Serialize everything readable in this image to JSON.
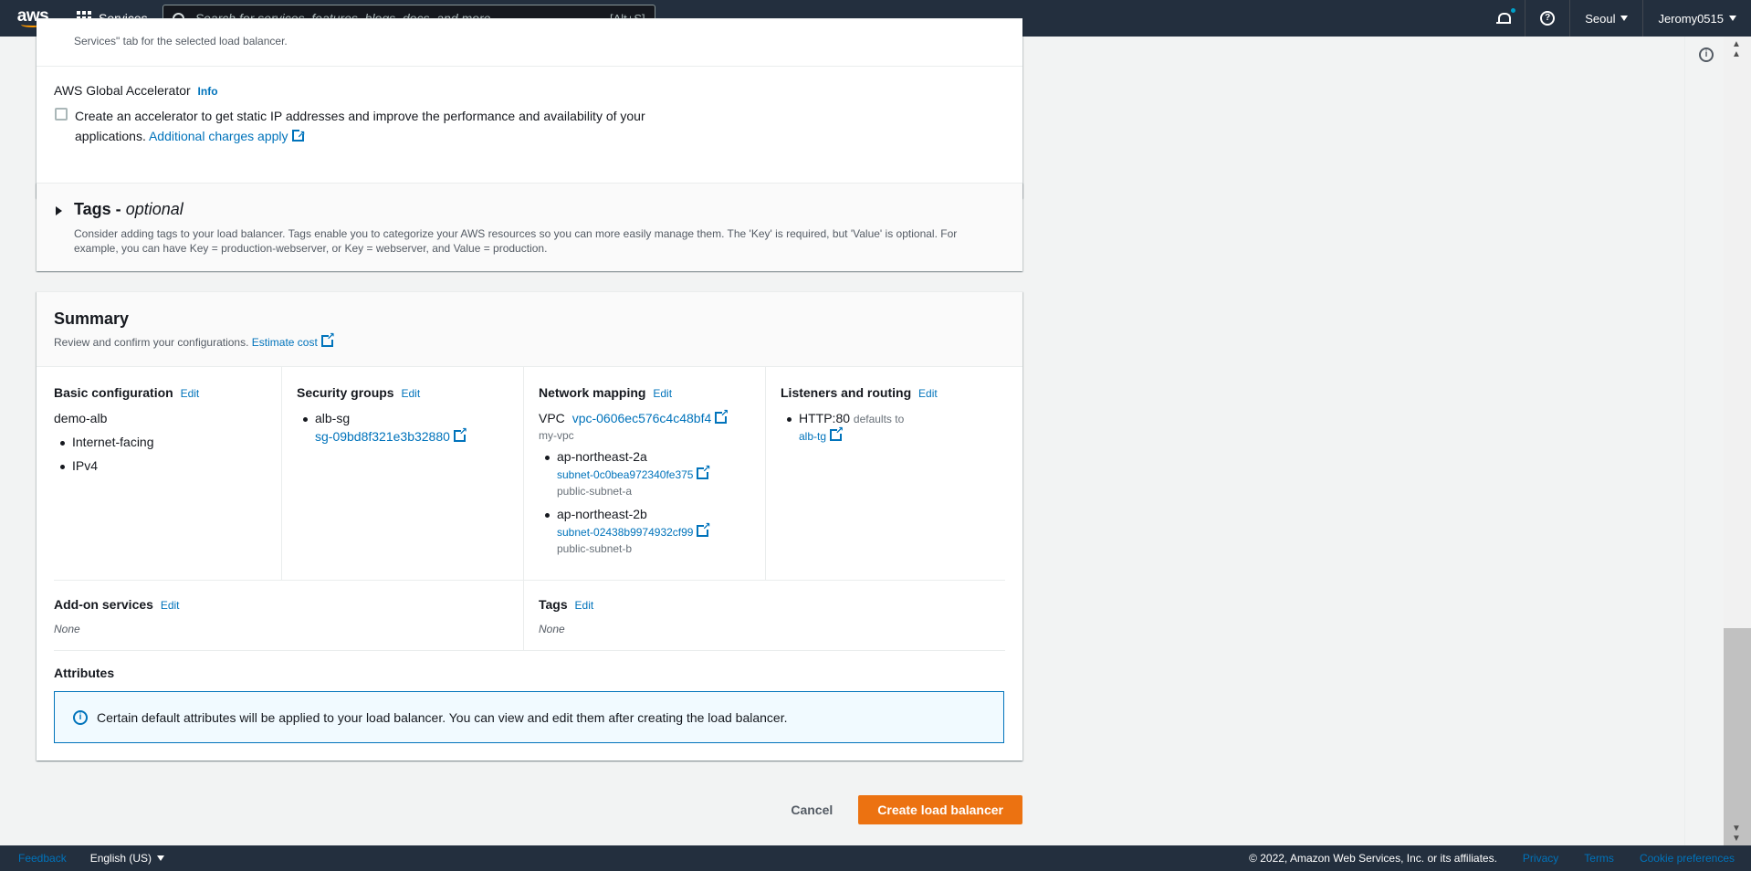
{
  "nav": {
    "logo": "aws",
    "services_label": "Services",
    "search_placeholder": "Search for services, features, blogs, docs, and more",
    "search_shortcut": "[Alt+S]",
    "region": "Seoul",
    "account": "Jeromy0515"
  },
  "panel_top": {
    "note": "Services\" tab for the selected load balancer.",
    "ga_title": "AWS Global Accelerator",
    "info": "Info",
    "ga_checkbox_text": "Create an accelerator to get static IP addresses and improve the performance and availability of your applications.",
    "ga_link": "Additional charges apply",
    "checked": false
  },
  "tags_panel": {
    "title": "Tags -",
    "title_optional": "optional",
    "description": "Consider adding tags to your load balancer. Tags enable you to categorize your AWS resources so you can more easily manage them. The 'Key' is required, but 'Value' is optional. For example, you can have Key = production-webserver, or Key = webserver, and Value = production."
  },
  "summary": {
    "title": "Summary",
    "description": "Review and confirm your configurations.",
    "estimate_link": "Estimate cost",
    "edit_label": "Edit",
    "basic": {
      "title": "Basic configuration",
      "name": "demo-alb",
      "items": [
        "Internet-facing",
        "IPv4"
      ]
    },
    "security_groups": {
      "title": "Security groups",
      "name": "alb-sg",
      "id": "sg-09bd8f321e3b32880"
    },
    "network": {
      "title": "Network mapping",
      "vpc_label": "VPC",
      "vpc_id": "vpc-0606ec576c4c48bf4",
      "vpc_name": "my-vpc",
      "zones": [
        {
          "az": "ap-northeast-2a",
          "subnet_id": "subnet-0c0bea972340fe375",
          "subnet_name": "public-subnet-a"
        },
        {
          "az": "ap-northeast-2b",
          "subnet_id": "subnet-02438b9974932cf99",
          "subnet_name": "public-subnet-b"
        }
      ]
    },
    "listeners": {
      "title": "Listeners and routing",
      "listener": "HTTP:80",
      "defaults_to": "defaults to",
      "target": "alb-tg"
    },
    "addon": {
      "title": "Add-on services",
      "value": "None"
    },
    "tags": {
      "title": "Tags",
      "value": "None"
    },
    "attributes": {
      "title": "Attributes",
      "alert": "Certain default attributes will be applied to your load balancer. You can view and edit them after creating the load balancer."
    }
  },
  "actions": {
    "cancel": "Cancel",
    "create": "Create load balancer"
  },
  "footer": {
    "feedback": "Feedback",
    "language": "English (US)",
    "copyright": "© 2022, Amazon Web Services, Inc. or its affiliates.",
    "privacy": "Privacy",
    "terms": "Terms",
    "cookies": "Cookie preferences"
  },
  "colors": {
    "nav_bg": "#232f3e",
    "link": "#0073bb",
    "primary_button": "#ec7211",
    "alert_bg": "#f1faff"
  }
}
